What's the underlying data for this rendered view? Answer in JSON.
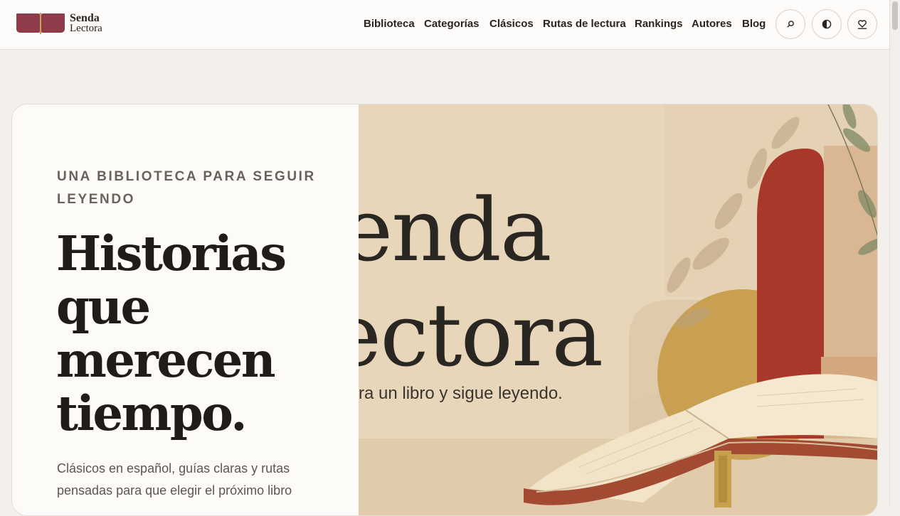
{
  "brand": {
    "line1": "Senda",
    "line2": "Lectora"
  },
  "nav": {
    "items": [
      "Biblioteca",
      "Categorías",
      "Clásicos",
      "Rutas de lectura",
      "Rankings",
      "Autores",
      "Blog"
    ]
  },
  "header_buttons": {
    "search_icon": "search-icon",
    "theme_icon": "contrast-icon",
    "saved_icon": "heart-bookmark-icon"
  },
  "hero": {
    "eyebrow": "UNA BIBLIOTECA PARA SEGUIR LEYENDO",
    "headline": "Historias que merecen tiempo.",
    "lead": "Clásicos en español, guías claras y rutas pensadas para que elegir el próximo libro",
    "image": {
      "word1": "enda",
      "word2": "ectora",
      "tagline": "ra un libro y sigue leyendo."
    }
  },
  "colors": {
    "accent": "#8f3b49",
    "background": "#f3efeb",
    "card": "#fdfbf7",
    "text": "#221d1a"
  }
}
